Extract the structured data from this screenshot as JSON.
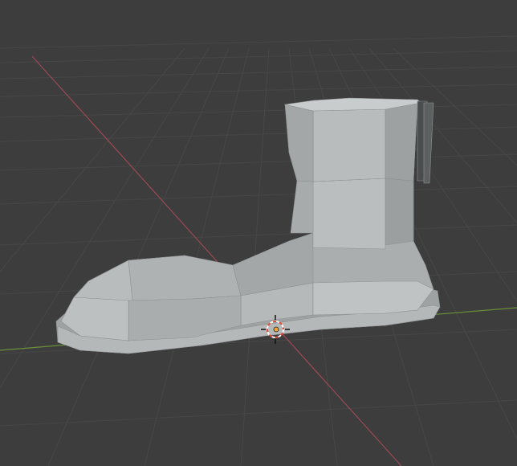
{
  "viewport": {
    "background": "#3d3d3d",
    "grid_color": "#474747",
    "x_axis_color": "#9a4a54",
    "y_axis_color": "#6a8f3a"
  },
  "scene": {
    "objects": [
      {
        "name": "Boot",
        "type": "mesh",
        "shading": "solid",
        "color": "#a8acad"
      }
    ],
    "cursor": {
      "name": "3d-cursor",
      "ring_color_a": "#e04c3a",
      "ring_color_b": "#ffffff"
    },
    "origin": {
      "name": "object-origin",
      "color": "#f0a23c"
    }
  }
}
